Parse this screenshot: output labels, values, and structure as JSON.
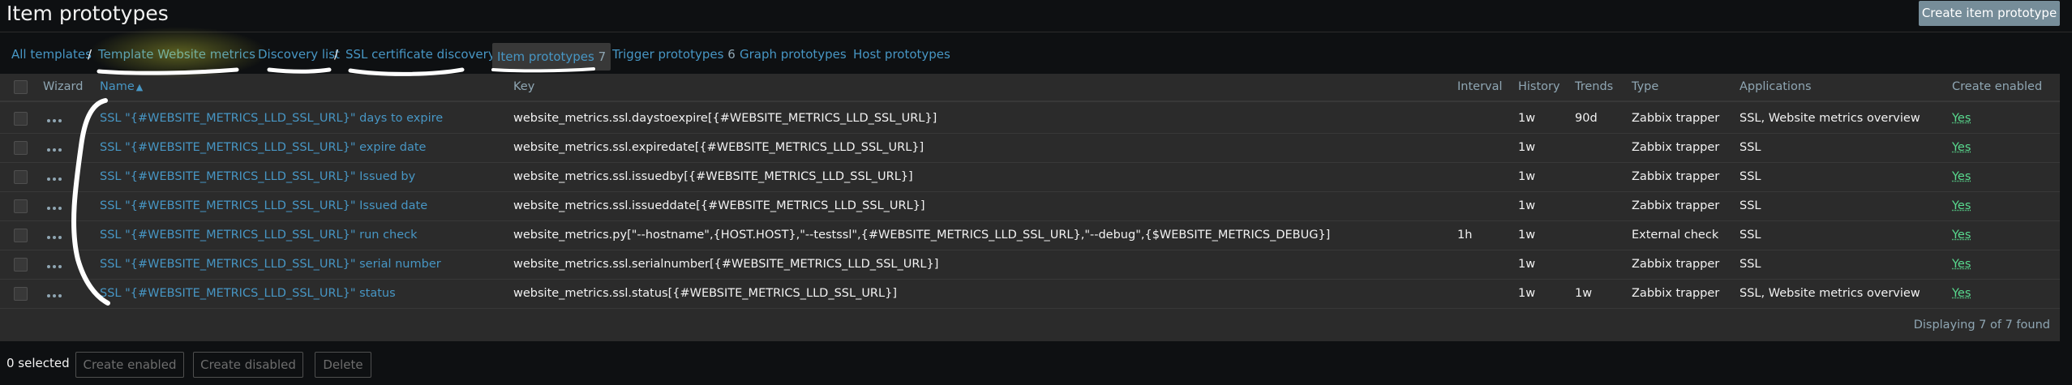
{
  "header": {
    "title": "Item prototypes",
    "create_button": "Create item prototype"
  },
  "nav": {
    "all_templates": "All templates",
    "sep1": "/",
    "template": "Template Website metrics",
    "discovery_list": "Discovery list",
    "sep2": "/",
    "discovery_rule": "SSL certificate discovery",
    "tabs": [
      {
        "label": "Item prototypes",
        "count": "7",
        "selected": true
      },
      {
        "label": "Trigger prototypes",
        "count": "6",
        "selected": false
      },
      {
        "label": "Graph prototypes",
        "count": "",
        "selected": false
      },
      {
        "label": "Host prototypes",
        "count": "",
        "selected": false
      }
    ]
  },
  "table": {
    "columns": {
      "wizard": "Wizard",
      "name": "Name",
      "sort_indicator": "▲",
      "key": "Key",
      "interval": "Interval",
      "history": "History",
      "trends": "Trends",
      "type": "Type",
      "applications": "Applications",
      "create_enabled": "Create enabled"
    },
    "rows": [
      {
        "name": "SSL \"{#WEBSITE_METRICS_LLD_SSL_URL}\" days to expire",
        "key": "website_metrics.ssl.daystoexpire[{#WEBSITE_METRICS_LLD_SSL_URL}]",
        "interval": "",
        "history": "1w",
        "trends": "90d",
        "type": "Zabbix trapper",
        "applications": "SSL, Website metrics overview",
        "create_enabled": "Yes"
      },
      {
        "name": "SSL \"{#WEBSITE_METRICS_LLD_SSL_URL}\" expire date",
        "key": "website_metrics.ssl.expiredate[{#WEBSITE_METRICS_LLD_SSL_URL}]",
        "interval": "",
        "history": "1w",
        "trends": "",
        "type": "Zabbix trapper",
        "applications": "SSL",
        "create_enabled": "Yes"
      },
      {
        "name": "SSL \"{#WEBSITE_METRICS_LLD_SSL_URL}\" Issued by",
        "key": "website_metrics.ssl.issuedby[{#WEBSITE_METRICS_LLD_SSL_URL}]",
        "interval": "",
        "history": "1w",
        "trends": "",
        "type": "Zabbix trapper",
        "applications": "SSL",
        "create_enabled": "Yes"
      },
      {
        "name": "SSL \"{#WEBSITE_METRICS_LLD_SSL_URL}\" Issued date",
        "key": "website_metrics.ssl.issueddate[{#WEBSITE_METRICS_LLD_SSL_URL}]",
        "interval": "",
        "history": "1w",
        "trends": "",
        "type": "Zabbix trapper",
        "applications": "SSL",
        "create_enabled": "Yes"
      },
      {
        "name": "SSL \"{#WEBSITE_METRICS_LLD_SSL_URL}\" run check",
        "key": "website_metrics.py[\"--hostname\",{HOST.HOST},\"--testssl\",{#WEBSITE_METRICS_LLD_SSL_URL},\"--debug\",{$WEBSITE_METRICS_DEBUG}]",
        "interval": "1h",
        "history": "1w",
        "trends": "",
        "type": "External check",
        "applications": "SSL",
        "create_enabled": "Yes"
      },
      {
        "name": "SSL \"{#WEBSITE_METRICS_LLD_SSL_URL}\" serial number",
        "key": "website_metrics.ssl.serialnumber[{#WEBSITE_METRICS_LLD_SSL_URL}]",
        "interval": "",
        "history": "1w",
        "trends": "",
        "type": "Zabbix trapper",
        "applications": "SSL",
        "create_enabled": "Yes"
      },
      {
        "name": "SSL \"{#WEBSITE_METRICS_LLD_SSL_URL}\" status",
        "key": "website_metrics.ssl.status[{#WEBSITE_METRICS_LLD_SSL_URL}]",
        "interval": "",
        "history": "1w",
        "trends": "1w",
        "type": "Zabbix trapper",
        "applications": "SSL, Website metrics overview",
        "create_enabled": "Yes"
      }
    ],
    "footer": "Displaying 7 of 7 found"
  },
  "actions": {
    "selected": "0 selected",
    "create_enabled": "Create enabled",
    "create_disabled": "Create disabled",
    "delete": "Delete"
  },
  "colors": {
    "background": "#0e1012",
    "panel": "#2b2b2b",
    "link": "#4796c4",
    "enabled": "#59db8f",
    "annotation": "#ffffff",
    "highlight": "#e8f03a"
  }
}
